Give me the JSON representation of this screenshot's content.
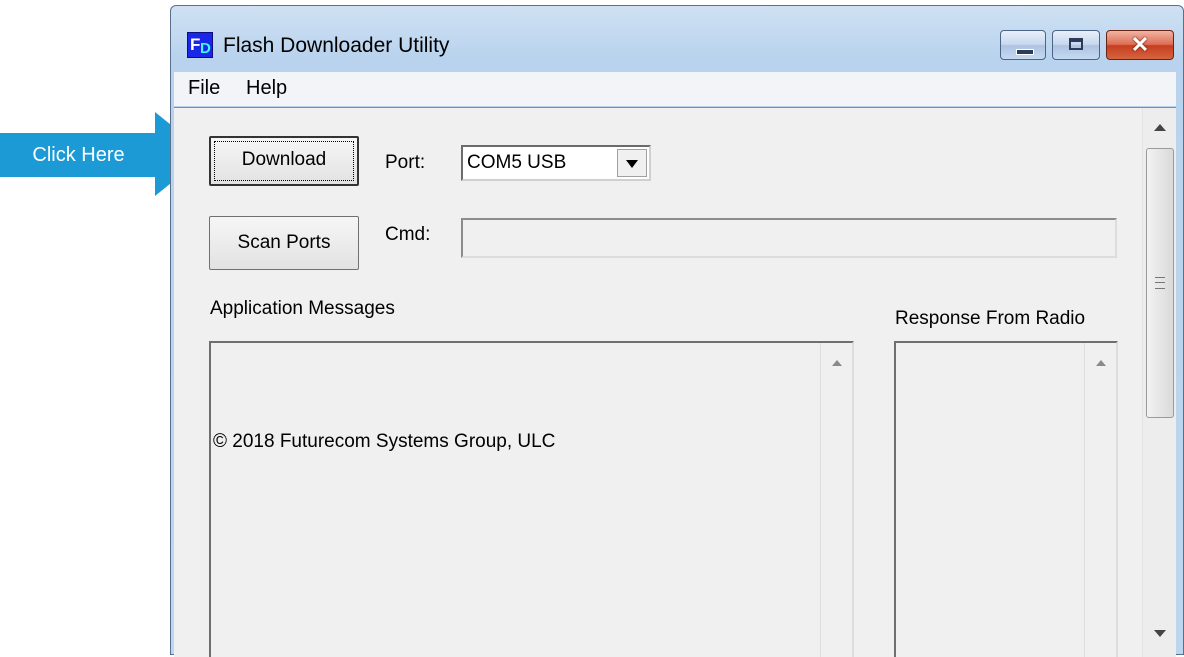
{
  "callout": {
    "label": "Click Here",
    "color": "#1b9ad6"
  },
  "window": {
    "title": "Flash Downloader Utility",
    "icon": "fd-app-icon",
    "icon_letters": {
      "first": "F",
      "second": "D"
    },
    "controls": {
      "close_glyph": "✕"
    }
  },
  "menu": {
    "file": "File",
    "help": "Help"
  },
  "form": {
    "download_label": "Download",
    "scan_ports_label": "Scan Ports",
    "port_label": "Port:",
    "port_value": "COM5 USB",
    "cmd_label": "Cmd:",
    "cmd_value": ""
  },
  "panels": {
    "app_messages_title": "Application Messages",
    "app_messages_text": "© 2018 Futurecom Systems Group, ULC",
    "response_title": "Response From Radio",
    "response_text": ""
  }
}
